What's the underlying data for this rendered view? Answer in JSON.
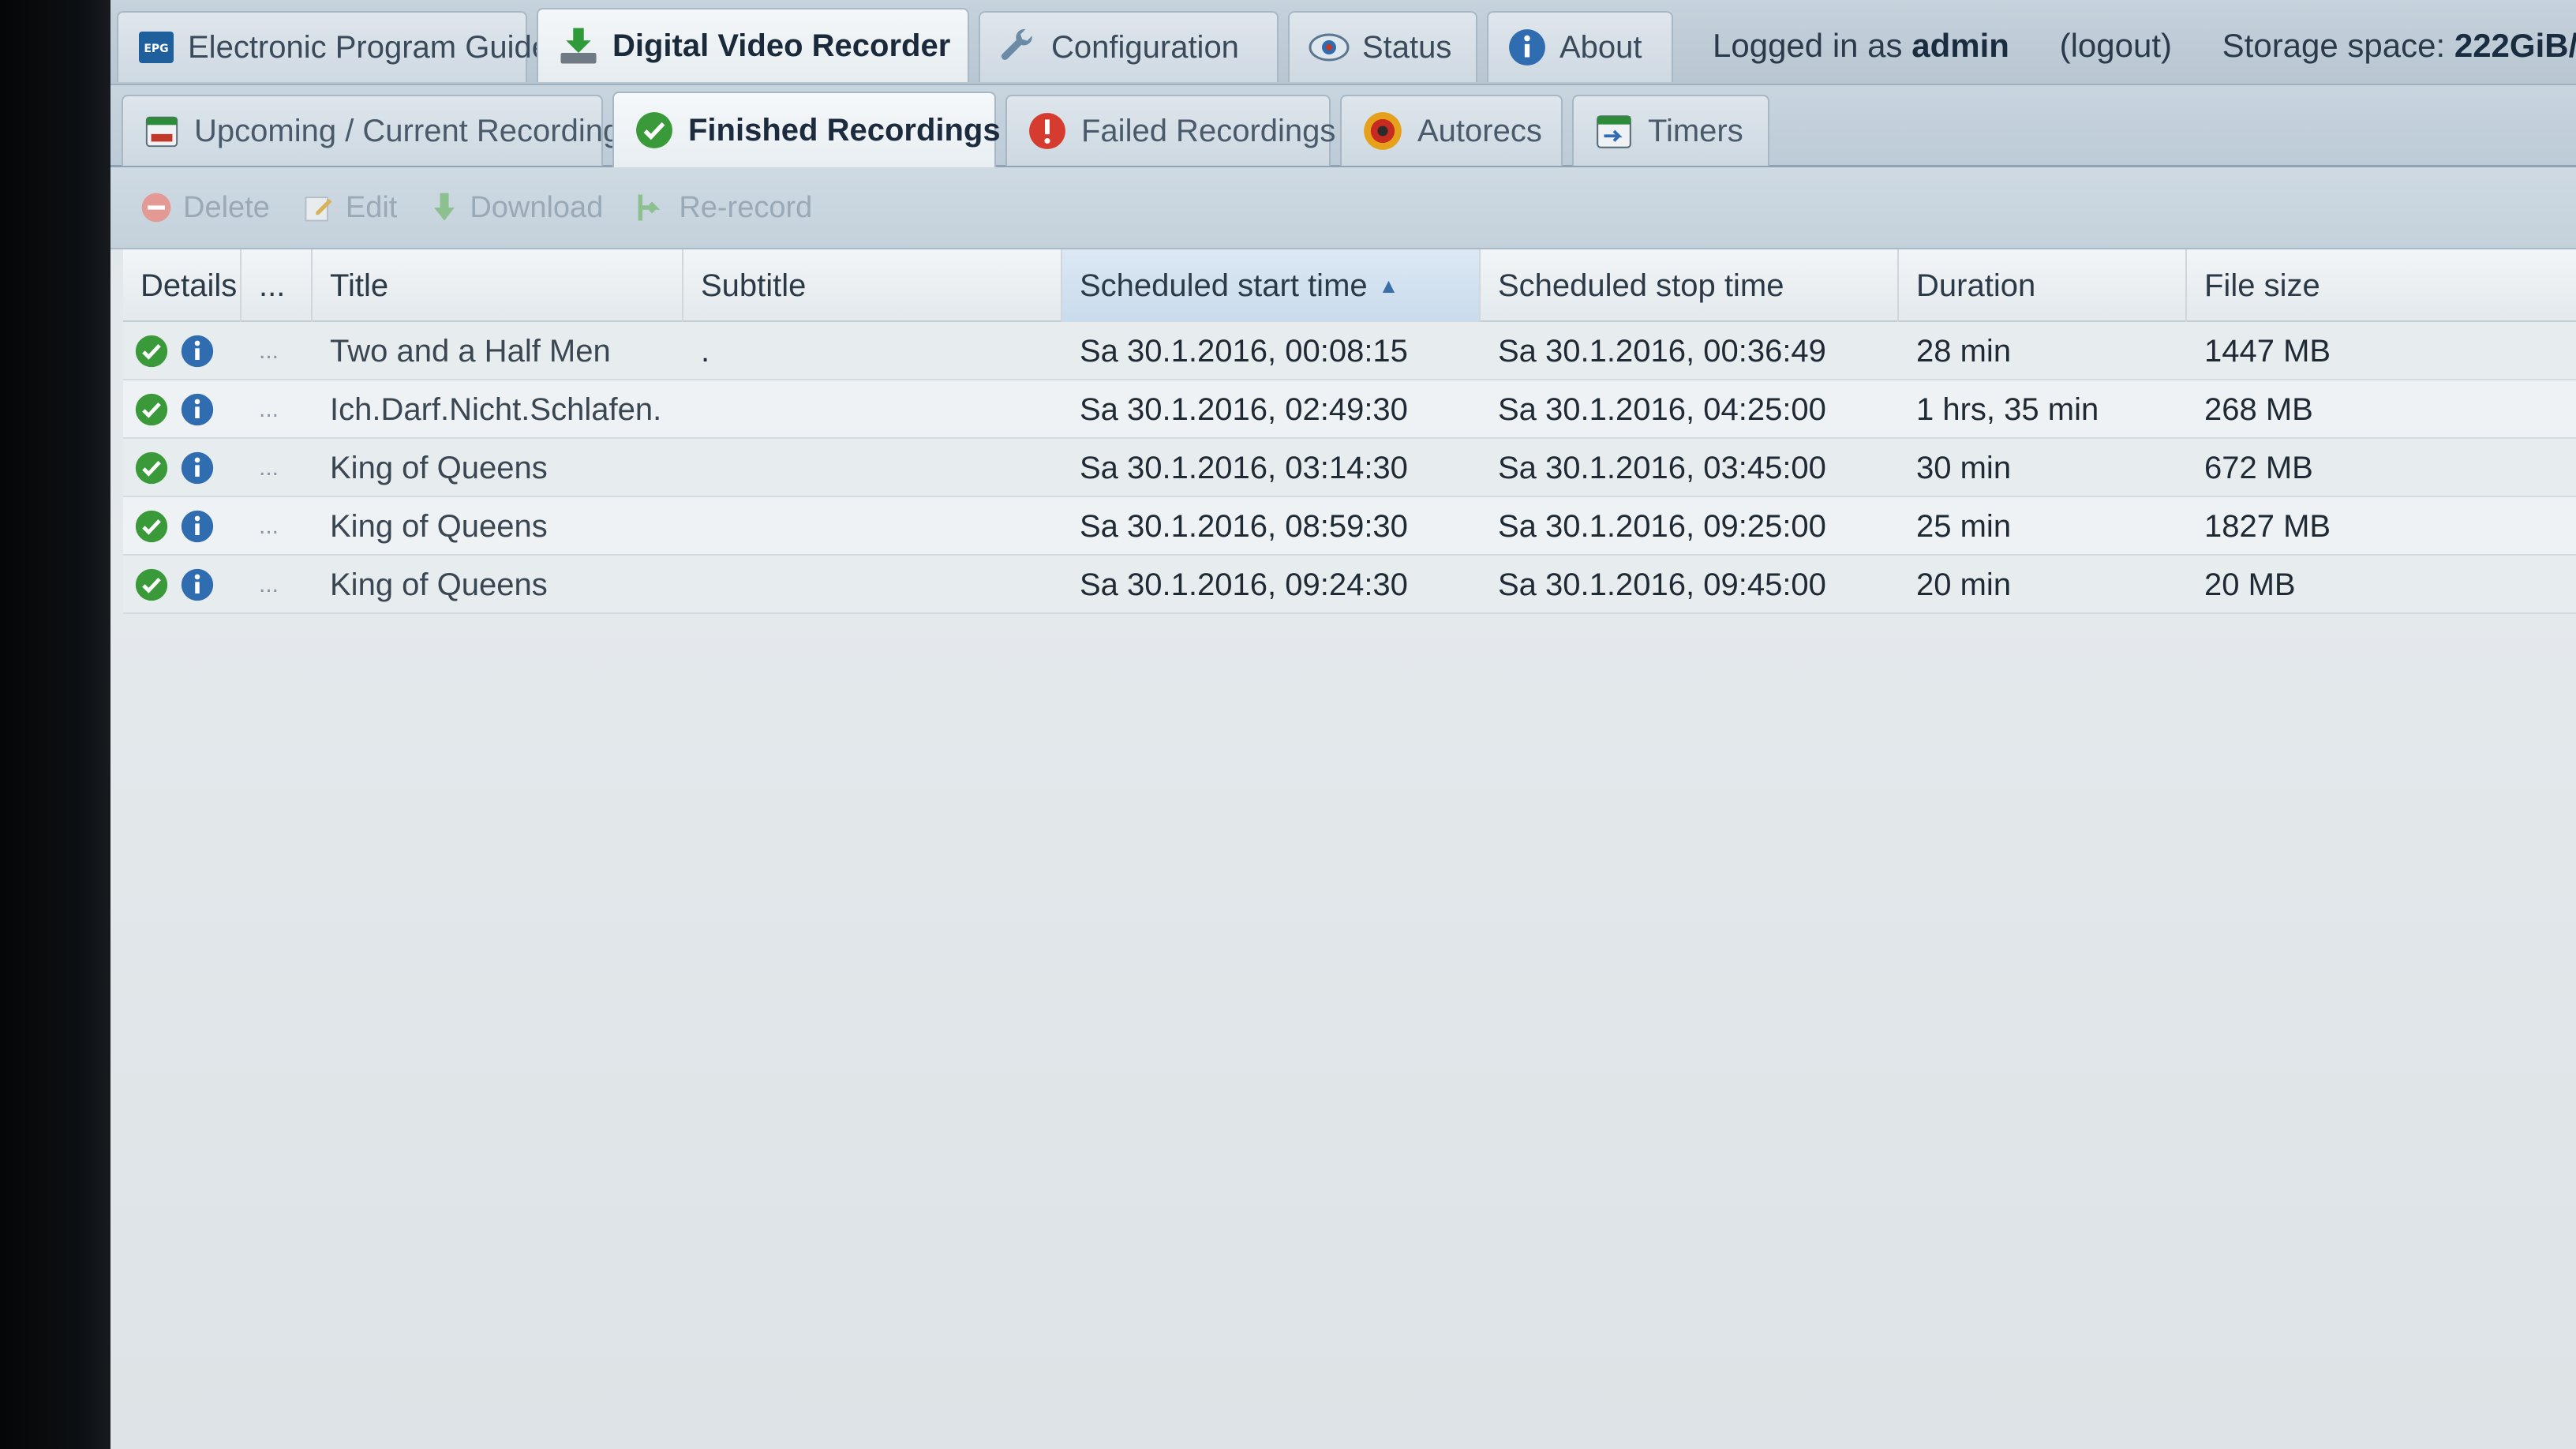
{
  "top_tabs": [
    {
      "label": "Electronic Program Guide",
      "icon": "epg-icon",
      "active": false
    },
    {
      "label": "Digital Video Recorder",
      "icon": "download-icon",
      "active": true
    },
    {
      "label": "Configuration",
      "icon": "wrench-icon",
      "active": false
    },
    {
      "label": "Status",
      "icon": "eye-icon",
      "active": false
    },
    {
      "label": "About",
      "icon": "info-icon",
      "active": false
    }
  ],
  "session": {
    "logged_in_prefix": "Logged in as",
    "username": "admin",
    "logout_label": "(logout)",
    "storage_prefix": "Storage space:",
    "storage_value": "222GiB/"
  },
  "sub_tabs": [
    {
      "label": "Upcoming / Current Recordings",
      "icon": "calendar-icon",
      "active": false
    },
    {
      "label": "Finished Recordings",
      "icon": "check-icon",
      "active": true
    },
    {
      "label": "Failed Recordings",
      "icon": "error-icon",
      "active": false
    },
    {
      "label": "Autorecs",
      "icon": "record-icon",
      "active": false
    },
    {
      "label": "Timers",
      "icon": "timer-icon",
      "active": false
    }
  ],
  "toolbar": {
    "delete_label": "Delete",
    "edit_label": "Edit",
    "download_label": "Download",
    "rerecord_label": "Re-record"
  },
  "grid": {
    "columns": {
      "details": "Details",
      "more": "...",
      "title": "Title",
      "subtitle": "Subtitle",
      "start": "Scheduled start time",
      "stop": "Scheduled stop time",
      "duration": "Duration",
      "filesize": "File size"
    },
    "rows": [
      {
        "more": "...",
        "title": "Two and a Half Men",
        "subtitle": ".",
        "start": "Sa 30.1.2016, 00:08:15",
        "stop": "Sa 30.1.2016, 00:36:49",
        "duration": "28 min",
        "filesize": "1447 MB"
      },
      {
        "more": "...",
        "title": "Ich.Darf.Nicht.Schlafen.",
        "subtitle": "",
        "start": "Sa 30.1.2016, 02:49:30",
        "stop": "Sa 30.1.2016, 04:25:00",
        "duration": "1 hrs, 35 min",
        "filesize": "268 MB"
      },
      {
        "more": "...",
        "title": "King of Queens",
        "subtitle": "",
        "start": "Sa 30.1.2016, 03:14:30",
        "stop": "Sa 30.1.2016, 03:45:00",
        "duration": "30 min",
        "filesize": "672 MB"
      },
      {
        "more": "...",
        "title": "King of Queens",
        "subtitle": "",
        "start": "Sa 30.1.2016, 08:59:30",
        "stop": "Sa 30.1.2016, 09:25:00",
        "duration": "25 min",
        "filesize": "1827 MB"
      },
      {
        "more": "...",
        "title": "King of Queens",
        "subtitle": "",
        "start": "Sa 30.1.2016, 09:24:30",
        "stop": "Sa 30.1.2016, 09:45:00",
        "duration": "20 min",
        "filesize": "20 MB"
      }
    ]
  },
  "colors": {
    "accent_blue": "#2f6db0",
    "success_green": "#3a9a3a",
    "error_red": "#d63b2f"
  }
}
